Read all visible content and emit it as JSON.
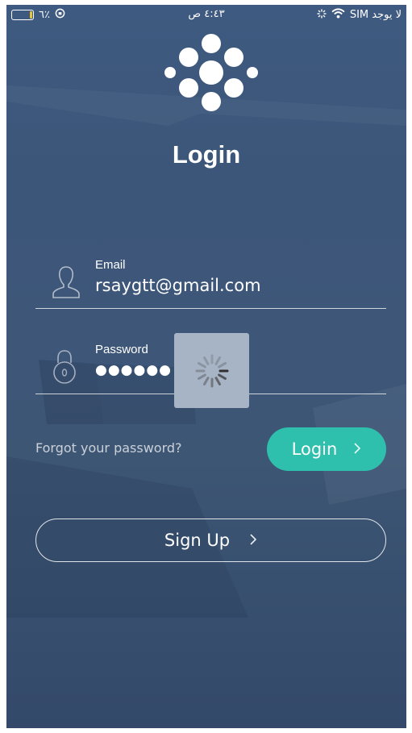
{
  "status_bar": {
    "battery_percent": "٦٪",
    "time": "٤:٤٣ ص",
    "carrier": "لا يوجد SIM"
  },
  "header": {
    "title": "Login"
  },
  "form": {
    "email": {
      "label": "Email",
      "value": "rsaygtt@gmail.com"
    },
    "password": {
      "label": "Password",
      "value": "●●●●●●"
    },
    "forgot_link": "Forgot your password?",
    "login_button": "Login",
    "signup_button": "Sign Up"
  },
  "colors": {
    "accent": "#2fbfad",
    "background": "#3d5677",
    "spinner_box": "#a7b4c6"
  },
  "icons": [
    "battery-icon",
    "orientation-lock-icon",
    "wifi-icon",
    "activity-icon",
    "logo-dots-icon",
    "user-icon",
    "lock-icon",
    "chevron-right-icon",
    "loading-spinner-icon"
  ]
}
